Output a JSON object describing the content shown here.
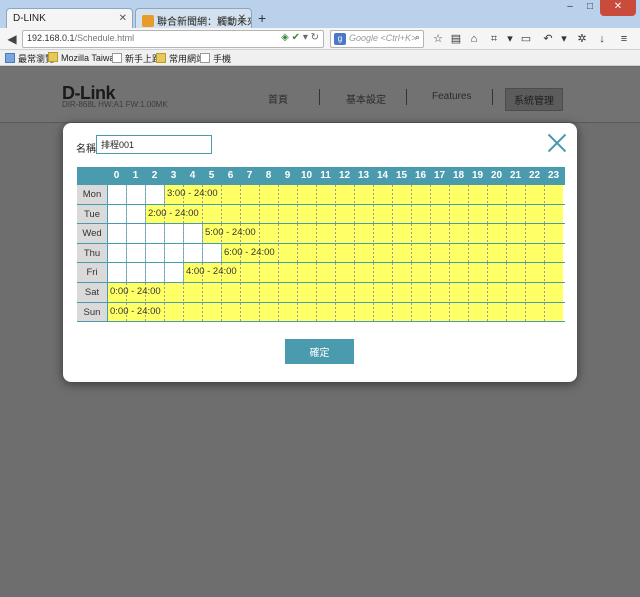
{
  "browser": {
    "tabs": [
      {
        "title": "D-LINK",
        "active": true
      },
      {
        "title": "聯合新聞網：觸動未來 新...",
        "active": false
      }
    ],
    "url": {
      "host": "192.168.0.1",
      "path": "/Schedule.html"
    },
    "search_placeholder": "Google <Ctrl+K>",
    "bookmarks": [
      "最常瀏覽",
      "Mozilla Taiwan",
      "新手上路",
      "常用網站",
      "手機"
    ]
  },
  "router_page": {
    "brand": "D-Link",
    "model_info": "DIR-868L   HW:A1   FW:1.00MK",
    "menu": [
      "首頁",
      "基本設定",
      "Features",
      "系統管理"
    ]
  },
  "modal": {
    "name_label": "名稱",
    "name_value": "排程001",
    "ok_label": "確定",
    "hours": [
      "0",
      "1",
      "2",
      "3",
      "4",
      "5",
      "6",
      "7",
      "8",
      "9",
      "10",
      "11",
      "12",
      "13",
      "14",
      "15",
      "16",
      "17",
      "18",
      "19",
      "20",
      "21",
      "22",
      "23"
    ],
    "schedule": [
      {
        "day": "Mon",
        "start": 3,
        "end": 24,
        "label": "3:00 - 24:00"
      },
      {
        "day": "Tue",
        "start": 2,
        "end": 24,
        "label": "2:00 - 24:00"
      },
      {
        "day": "Wed",
        "start": 5,
        "end": 24,
        "label": "5:00 - 24:00"
      },
      {
        "day": "Thu",
        "start": 6,
        "end": 24,
        "label": "6:00 - 24:00"
      },
      {
        "day": "Fri",
        "start": 4,
        "end": 24,
        "label": "4:00 - 24:00"
      },
      {
        "day": "Sat",
        "start": 0,
        "end": 24,
        "label": "0:00 - 24:00"
      },
      {
        "day": "Sun",
        "start": 0,
        "end": 24,
        "label": "0:00 - 24:00"
      }
    ]
  },
  "colors": {
    "accent": "#4a9bad",
    "schedule_fill": "#ffff66"
  }
}
